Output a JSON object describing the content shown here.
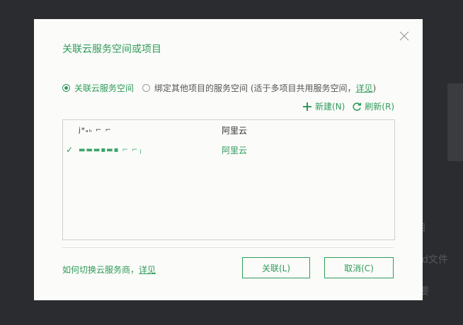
{
  "background": {
    "peek_texts": [
      "目",
      "d文件",
      "要"
    ]
  },
  "dialog": {
    "title": "关联云服务空间或项目",
    "radio_options": [
      {
        "label": "关联云服务空间",
        "checked": true
      },
      {
        "label": "绑定其他项目的服务空间 (适于多项目共用服务空间，",
        "link": "详见",
        "suffix": ")",
        "checked": false
      }
    ],
    "toolbar": {
      "new_label": "新建(N)",
      "refresh_label": "刷新(R)"
    },
    "spaces": [
      {
        "name": "j*ₐₕ ⌐ ⌐",
        "provider": "阿里云",
        "selected": false
      },
      {
        "name": "▬▬▬▪▬▪ ⌐ ⌐╷",
        "provider": "阿里云",
        "selected": true
      }
    ],
    "help_text": "如何切换云服务商，",
    "help_link": "详见",
    "link_button": "关联(L)",
    "cancel_button": "取消(C)",
    "colors": {
      "accent": "#2f9a5c",
      "dialog_bg": "#fbfcf9",
      "backdrop": "#2a2c2f"
    }
  }
}
